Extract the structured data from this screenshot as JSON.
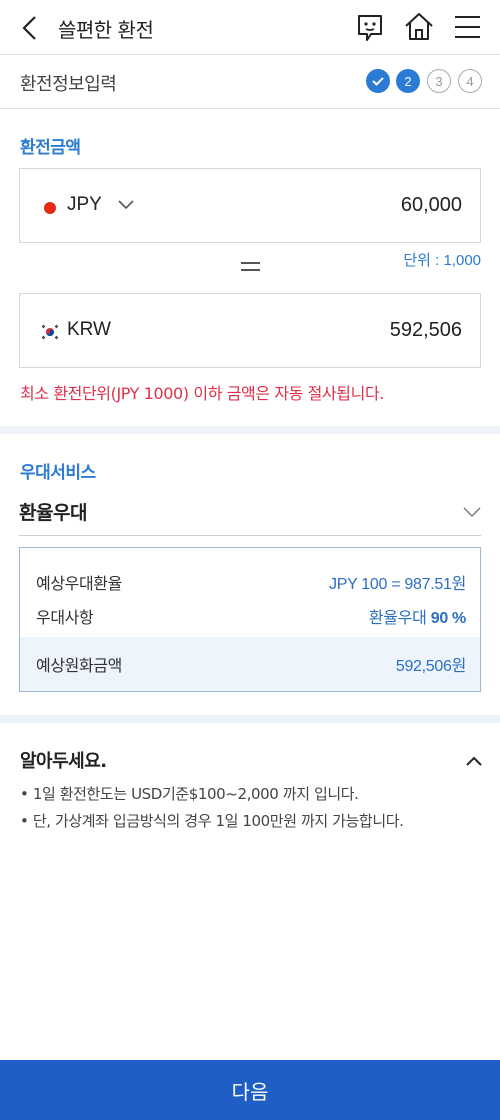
{
  "header": {
    "title": "쓸편한 환전",
    "icons": [
      "back-arrow-icon",
      "chat-icon",
      "home-icon",
      "menu-icon"
    ]
  },
  "steps": {
    "title": "환전정보입력",
    "items": [
      "",
      "2",
      "3",
      "4"
    ],
    "current": 2
  },
  "exchange": {
    "section_label": "환전금액",
    "from": {
      "currency": "JPY",
      "amount": "60,000"
    },
    "unit_note": "단위 : 1,000",
    "to": {
      "currency": "KRW",
      "amount": "592,506"
    },
    "warning": "최소 환전단위(JPY 1000) 이하 금액은 자동 절사됩니다."
  },
  "preferential": {
    "section_label": "우대서비스",
    "selected": "환율우대",
    "expected_rate_label": "예상우대환율",
    "expected_rate_value": "JPY 100 = 987.51원",
    "benefit_label": "우대사항",
    "benefit_prefix": "환율우대",
    "benefit_value": "90 %",
    "expected_krw_label": "예상원화금액",
    "expected_krw_value": "592,506원"
  },
  "notice": {
    "title": "알아두세요.",
    "items": [
      "• 1일 환전한도는 USD기준$100~2,000 까지 입니다.",
      "• 단, 가상계좌 입금방식의 경우 1일 100만원 까지 가능합니다."
    ]
  },
  "footer": {
    "next_label": "다음"
  },
  "colors": {
    "accent": "#2b7bd4",
    "primary_button": "#1f5fc5",
    "warning": "#e0304a",
    "jpy_dot": "#e32b14"
  }
}
